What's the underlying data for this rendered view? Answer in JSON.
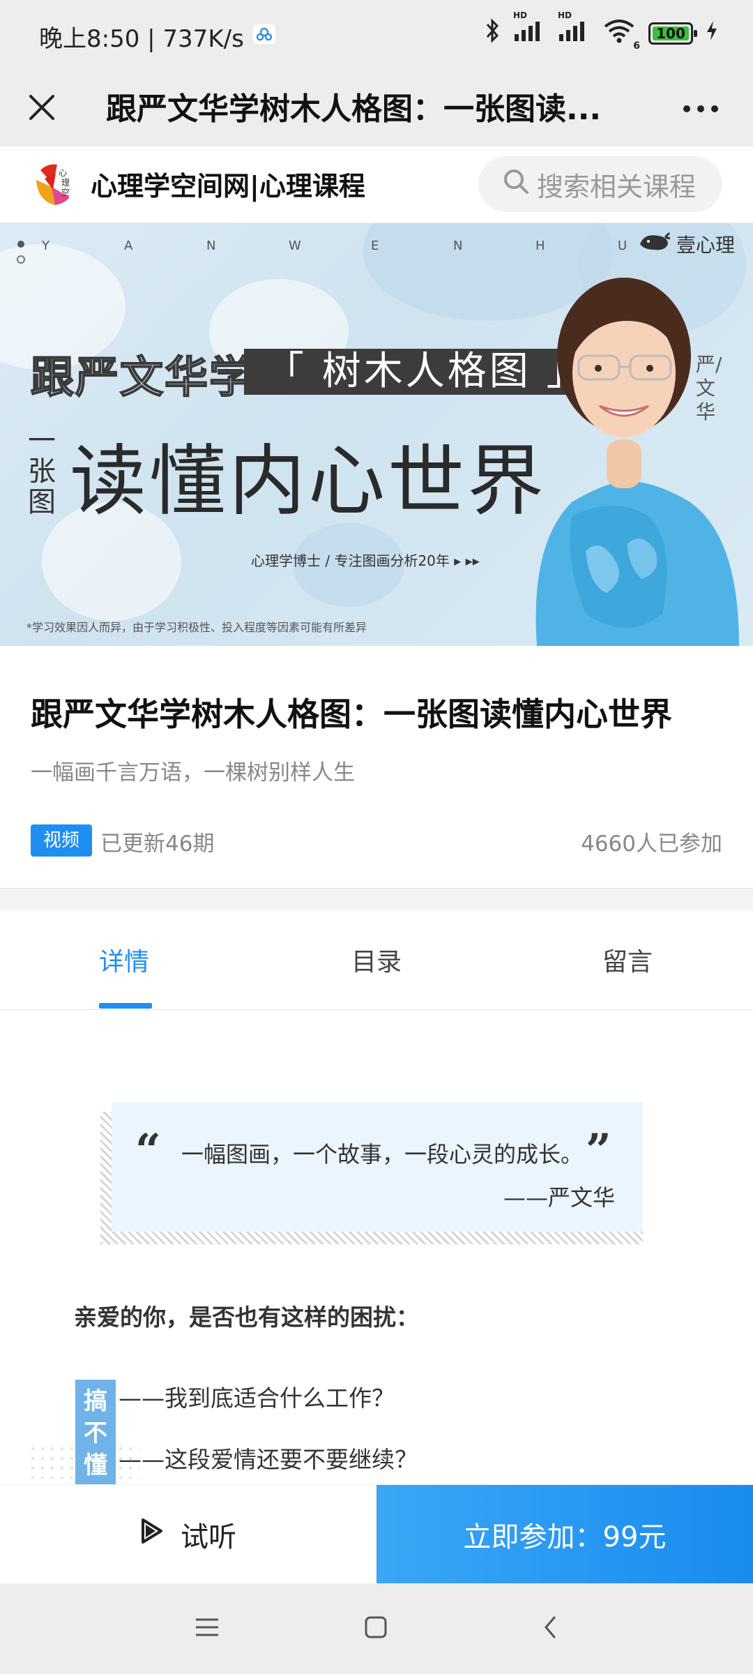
{
  "status_bar": {
    "time_speed": "晚上8:50 | 737K/s",
    "battery": "100",
    "hd1": "HD",
    "hd2": "HD",
    "wifi_badge": "6"
  },
  "title_bar": {
    "title": "跟严文华学树木人格图：一张图读..."
  },
  "site_header": {
    "name": "心理学空间网|心理课程",
    "search_placeholder": "搜索相关课程"
  },
  "banner": {
    "letters": [
      "Y",
      "A",
      "N",
      "W",
      "E",
      "N",
      "H",
      "U"
    ],
    "brand": "壹心理",
    "line1": "跟严文华学",
    "line2": "「 树木人格图 」",
    "line3_small": "一张图",
    "line3": "读懂内心世界",
    "credentials": "心理学博士  /  专注图画分析20年  ▸ ▸▸",
    "disclaimer": "*学习效果因人而异，由于学习积极性、投入程度等因素可能有所差异",
    "signature": "严/文华"
  },
  "course": {
    "title": "跟严文华学树木人格图：一张图读懂内心世界",
    "subtitle": "一幅画千言万语，一棵树别样人生",
    "tag": "视频",
    "updated": "已更新46期",
    "joined": "4660人已参加"
  },
  "tabs": [
    {
      "label": "详情",
      "active": true
    },
    {
      "label": "目录",
      "active": false
    },
    {
      "label": "留言",
      "active": false
    }
  ],
  "detail": {
    "quote": "一幅图画，一个故事，一段心灵的成长。",
    "quote_open": "“",
    "quote_close": "”",
    "quote_author": "——严文华",
    "question": "亲爱的你，是否也有这样的困扰：",
    "side_label": "搞不懂自",
    "items": [
      "——我到底适合什么工作？",
      "——这段爱情还要不要继续？"
    ]
  },
  "actions": {
    "trial": "试听",
    "join": "立即参加：99元"
  },
  "colors": {
    "accent": "#1f8ef1",
    "status_bg": "#ededed"
  }
}
